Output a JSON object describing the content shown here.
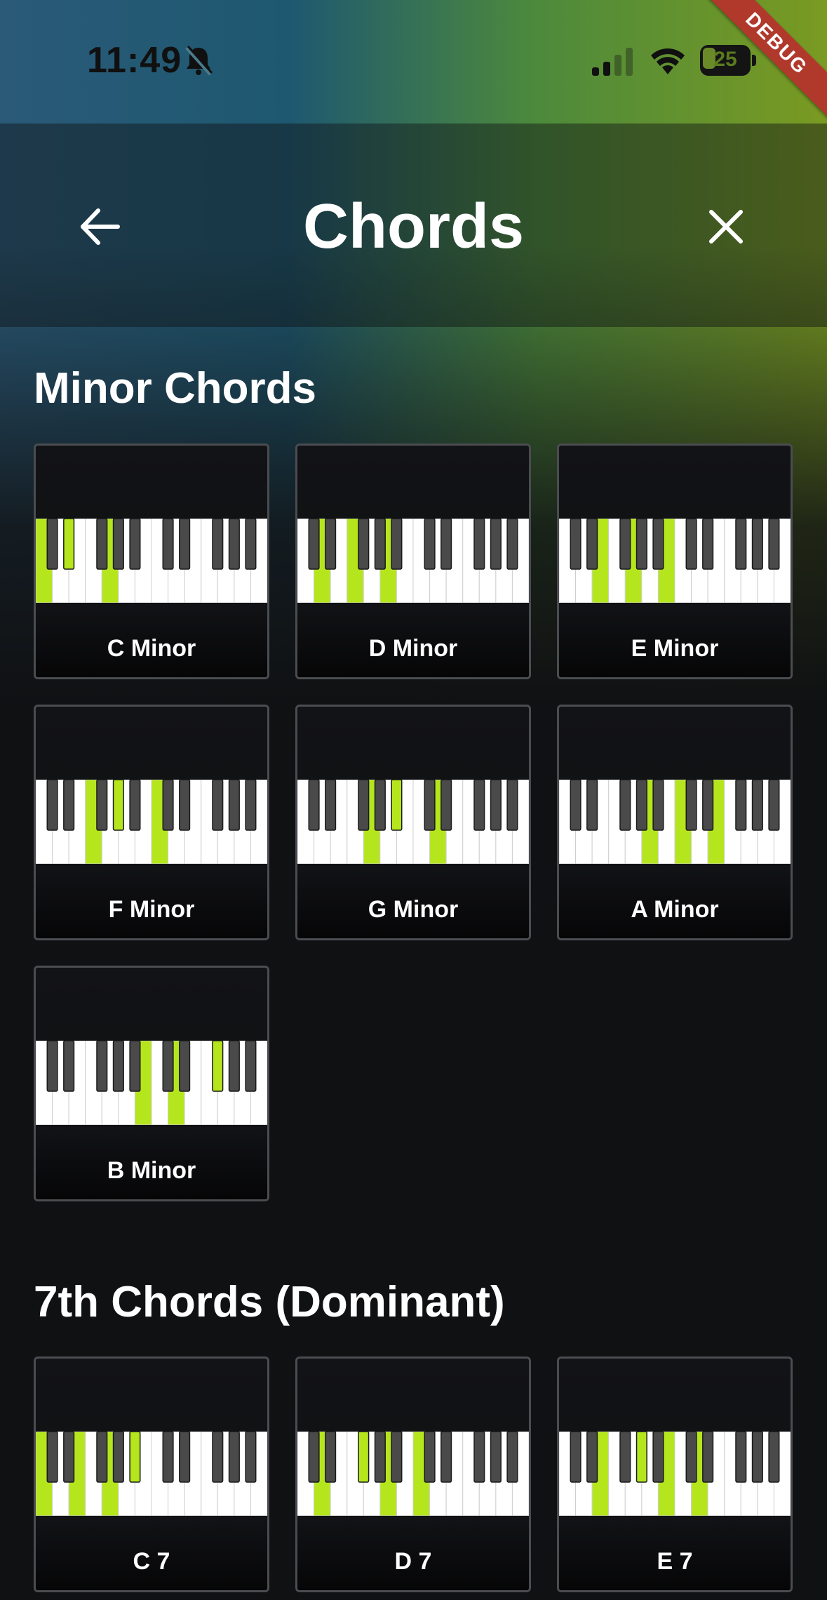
{
  "status_bar": {
    "time": "11:49",
    "battery": "25"
  },
  "debug_banner": "DEBUG",
  "app_bar": {
    "title": "Chords"
  },
  "sections": [
    {
      "title": "Minor Chords",
      "chords": [
        {
          "name": "C Minor",
          "keys": [
            0,
            3,
            7
          ]
        },
        {
          "name": "D Minor",
          "keys": [
            2,
            5,
            9
          ]
        },
        {
          "name": "E Minor",
          "keys": [
            4,
            7,
            11
          ]
        },
        {
          "name": "F Minor",
          "keys": [
            5,
            8,
            12
          ]
        },
        {
          "name": "G Minor",
          "keys": [
            7,
            10,
            14
          ]
        },
        {
          "name": "A Minor",
          "keys": [
            9,
            12,
            16
          ]
        },
        {
          "name": "B Minor",
          "keys": [
            11,
            14,
            18
          ]
        }
      ]
    },
    {
      "title": "7th Chords (Dominant)",
      "chords": [
        {
          "name": "C 7",
          "keys": [
            0,
            4,
            7,
            10
          ]
        },
        {
          "name": "D 7",
          "keys": [
            2,
            6,
            9,
            12
          ]
        },
        {
          "name": "E 7",
          "keys": [
            4,
            8,
            11,
            14
          ]
        }
      ]
    }
  ],
  "colors": {
    "highlight": "#b5e61d",
    "black_key": "#4a4a4a",
    "white_key": "#ffffff",
    "debug_ribbon": "#b0392c"
  }
}
